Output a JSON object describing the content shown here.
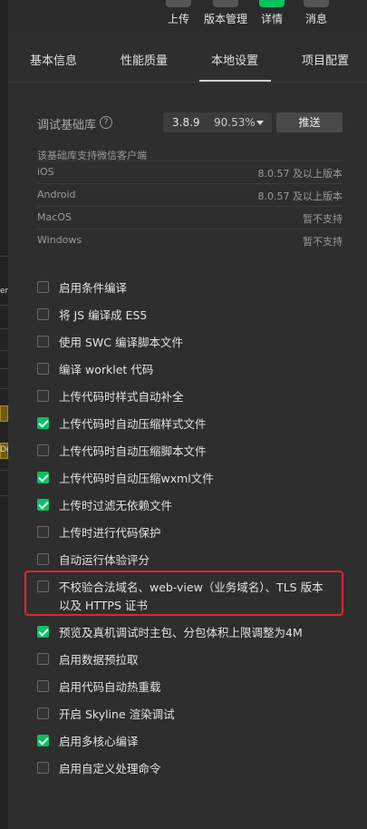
{
  "toolbar": {
    "items": [
      {
        "label": "上传"
      },
      {
        "label": "版本管理"
      },
      {
        "label": "详情"
      },
      {
        "label": "消息"
      }
    ]
  },
  "left_strip": {
    "fragments": [
      "er",
      "De"
    ]
  },
  "tabs": [
    {
      "label": "基本信息",
      "active": false
    },
    {
      "label": "性能质量",
      "active": false
    },
    {
      "label": "本地设置",
      "active": true
    },
    {
      "label": "项目配置",
      "active": false
    }
  ],
  "debug_lib": {
    "label": "调试基础库",
    "help_icon": "?",
    "version": "3.8.9",
    "percent": "90.53%",
    "push_label": "推送"
  },
  "support": {
    "note": "该基础库支持微信客户端",
    "platforms": [
      {
        "name": "iOS",
        "value": "8.0.57 及以上版本"
      },
      {
        "name": "Android",
        "value": "8.0.57 及以上版本"
      },
      {
        "name": "MacOS",
        "value": "暂不支持"
      },
      {
        "name": "Windows",
        "value": "暂不支持"
      }
    ]
  },
  "options": [
    {
      "label": "启用条件编译",
      "checked": false
    },
    {
      "label": "将 JS 编译成 ES5",
      "checked": false
    },
    {
      "label": "使用 SWC 编译脚本文件",
      "checked": false
    },
    {
      "label": "编译 worklet 代码",
      "checked": false
    },
    {
      "label": "上传代码时样式自动补全",
      "checked": false
    },
    {
      "label": "上传代码时自动压缩样式文件",
      "checked": true
    },
    {
      "label": "上传代码时自动压缩脚本文件",
      "checked": false
    },
    {
      "label": "上传代码时自动压缩wxml文件",
      "checked": true
    },
    {
      "label": "上传时过滤无依赖文件",
      "checked": true
    },
    {
      "label": "上传时进行代码保护",
      "checked": false
    },
    {
      "label": "自动运行体验评分",
      "checked": false
    },
    {
      "label": "不校验合法域名、web-view（业务域名）、TLS 版本以及 HTTPS 证书",
      "checked": false
    },
    {
      "label": "预览及真机调试时主包、分包体积上限调整为4M",
      "checked": true
    },
    {
      "label": "启用数据预拉取",
      "checked": false
    },
    {
      "label": "启用代码自动热重载",
      "checked": false
    },
    {
      "label": "开启 Skyline 渲染调试",
      "checked": false
    },
    {
      "label": "启用多核心编译",
      "checked": true
    },
    {
      "label": "启用自定义处理命令",
      "checked": false
    }
  ],
  "colors": {
    "accent_green": "#07c160",
    "highlight_red": "#e0262a",
    "background": "#2e2e2e"
  }
}
